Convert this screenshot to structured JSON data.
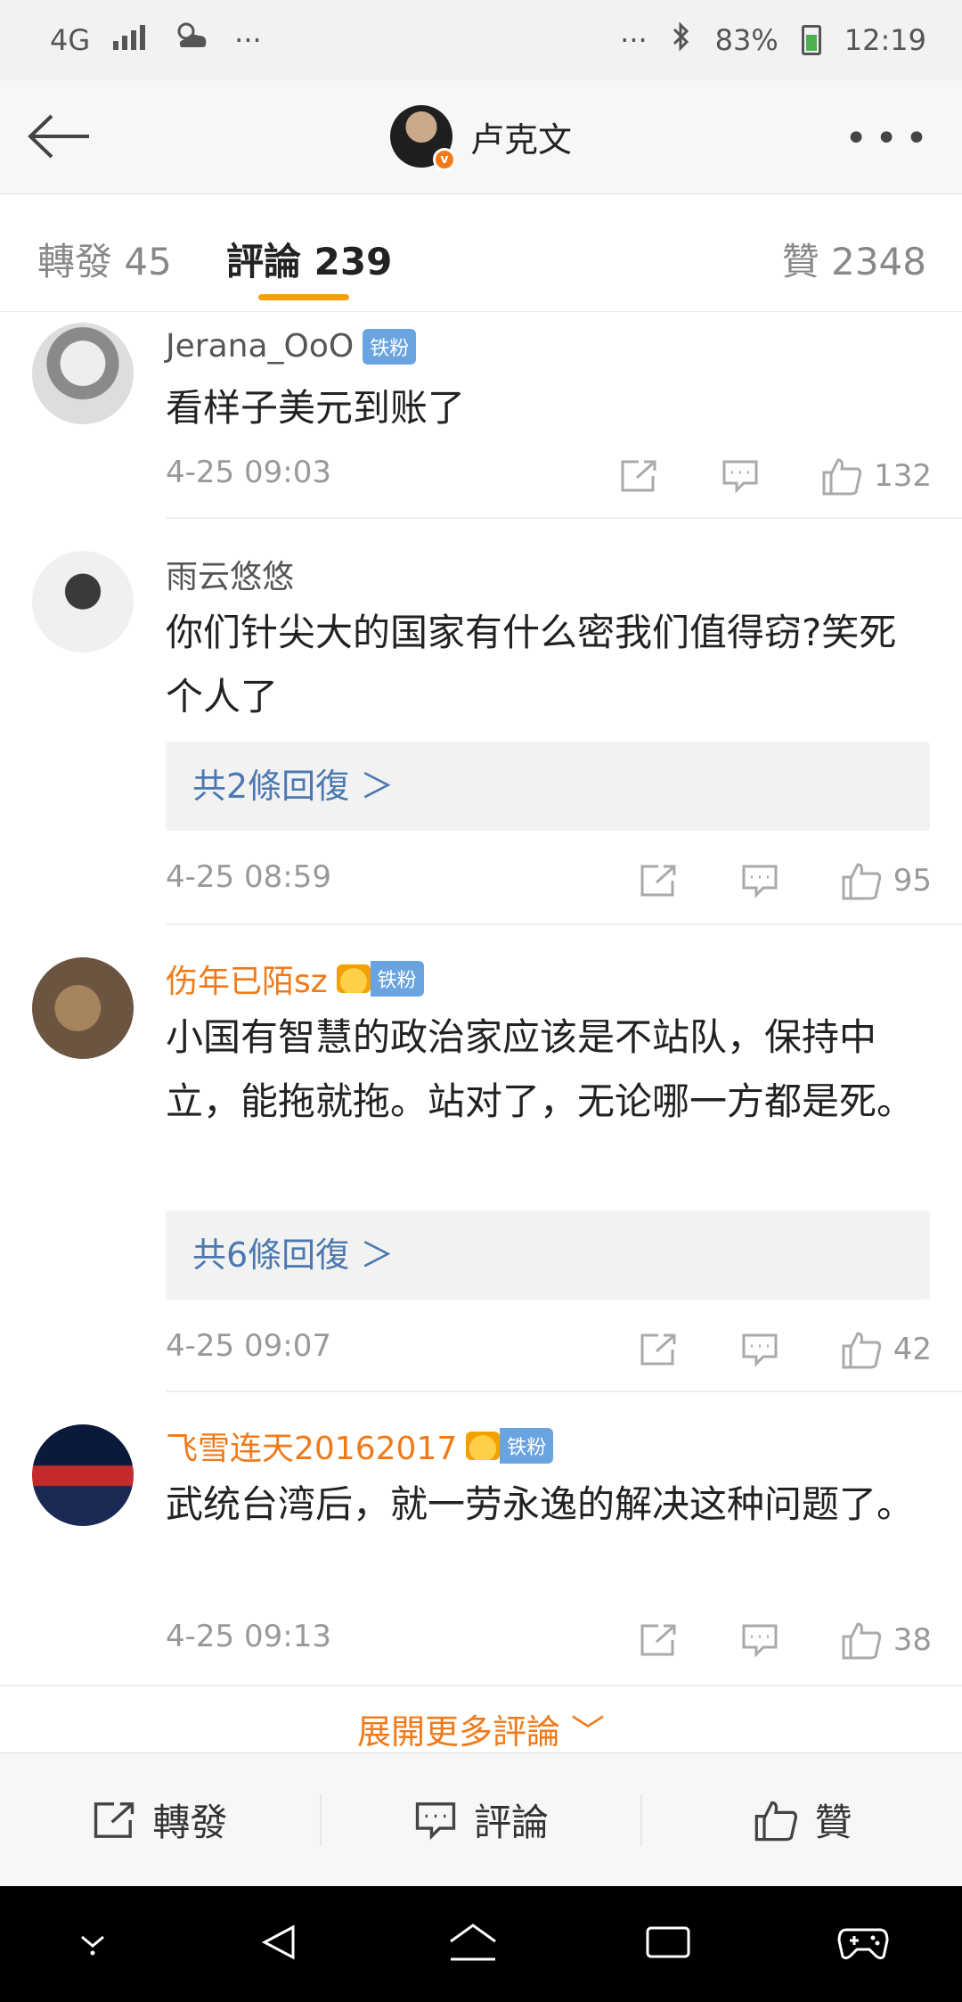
{
  "status_bar": {
    "network": "4G",
    "overflow": "···",
    "battery_percent": "83%",
    "time": "12:19"
  },
  "nav": {
    "title": "卢克文",
    "badge": "v"
  },
  "tabs": {
    "repost": "轉發 45",
    "comments": "評論 239",
    "likes": "贊 2348"
  },
  "comments": [
    {
      "user": "Jerana_OoO",
      "badge": "铁粉",
      "text": "看样子美元到账了",
      "time": "4-25 09:03",
      "likes": "132",
      "reply_label": ""
    },
    {
      "user": "雨云悠悠",
      "badge": "",
      "text": "你们针尖大的国家有什么密我们值得窃?笑死个人了",
      "time": "4-25 08:59",
      "likes": "95",
      "reply_label": "共2條回復 ＞"
    },
    {
      "user": "伤年已陌sz",
      "badge": "铁粉",
      "text": "小国有智慧的政治家应该是不站队，保持中立，能拖就拖。站对了，无论哪一方都是死。",
      "time": "4-25 09:07",
      "likes": "42",
      "reply_label": "共6條回復 ＞"
    },
    {
      "user": "飞雪连天20162017",
      "badge": "铁粉",
      "text": "武统台湾后，就一劳永逸的解决这种问题了。",
      "time": "4-25 09:13",
      "likes": "38",
      "reply_label": ""
    }
  ],
  "more_comments": "展開更多評論 ﹀",
  "actionbar": {
    "repost": "轉發",
    "comment": "評論",
    "like": "贊"
  },
  "colors": {
    "accent_orange": "#f59f00",
    "link_blue": "#4a78b0",
    "vip_name": "#f07a1a",
    "fan_badge": "#6aa4e0"
  }
}
